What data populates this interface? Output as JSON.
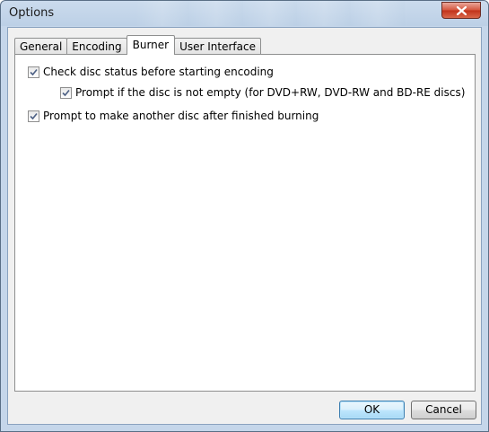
{
  "window": {
    "title": "Options",
    "close_icon": "close-icon"
  },
  "tabs": [
    {
      "label": "General",
      "active": false
    },
    {
      "label": "Encoding",
      "active": false
    },
    {
      "label": "Burner",
      "active": true
    },
    {
      "label": "User Interface",
      "active": false
    }
  ],
  "burner": {
    "check_disc_status": {
      "label": "Check disc status before starting encoding",
      "checked": true
    },
    "prompt_not_empty": {
      "label": "Prompt if the disc is not empty (for DVD+RW, DVD-RW and BD-RE discs)",
      "checked": true
    },
    "prompt_another_disc": {
      "label": "Prompt to make another disc after finished burning",
      "checked": true
    }
  },
  "buttons": {
    "ok": "OK",
    "cancel": "Cancel"
  }
}
